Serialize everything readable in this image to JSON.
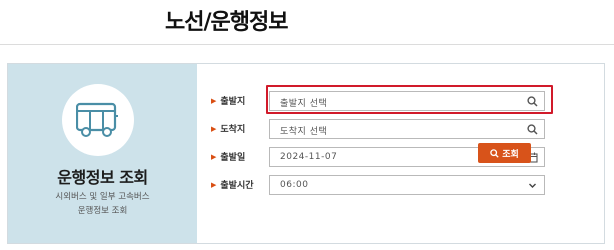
{
  "header": {
    "title": "노선/운행정보"
  },
  "intro": {
    "icon": "bus-icon",
    "title": "운행정보 조회",
    "subtitle_line1": "시외버스 및 일부 고속버스",
    "subtitle_line2": "운행정보 조회"
  },
  "form": {
    "departure": {
      "label": "출발지",
      "placeholder": "출발지 선택",
      "icon": "search-icon"
    },
    "arrival": {
      "label": "도착지",
      "placeholder": "도착지 선택",
      "icon": "search-icon"
    },
    "date": {
      "label": "출발일",
      "value": "2024-11-07",
      "icon": "calendar-icon"
    },
    "time": {
      "label": "출발시간",
      "value": "06:00",
      "icon": "chevron-down-icon"
    },
    "search_button": {
      "label": "조회",
      "icon": "search-icon"
    }
  },
  "colors": {
    "accent": "#d8531a",
    "panel_bg": "#cde2ea",
    "highlight": "#d11a2a"
  }
}
